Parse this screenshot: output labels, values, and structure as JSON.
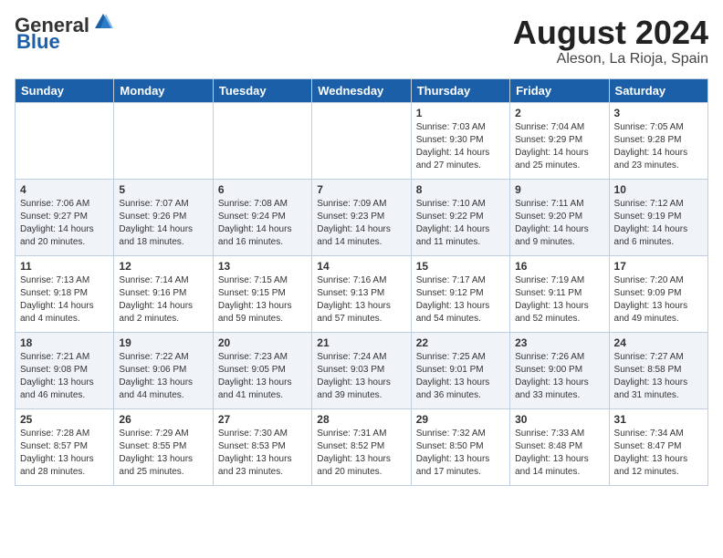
{
  "header": {
    "logo_general": "General",
    "logo_blue": "Blue",
    "month_year": "August 2024",
    "location": "Aleson, La Rioja, Spain"
  },
  "weekdays": [
    "Sunday",
    "Monday",
    "Tuesday",
    "Wednesday",
    "Thursday",
    "Friday",
    "Saturday"
  ],
  "weeks": [
    [
      {
        "day": "",
        "info": ""
      },
      {
        "day": "",
        "info": ""
      },
      {
        "day": "",
        "info": ""
      },
      {
        "day": "",
        "info": ""
      },
      {
        "day": "1",
        "info": "Sunrise: 7:03 AM\nSunset: 9:30 PM\nDaylight: 14 hours\nand 27 minutes."
      },
      {
        "day": "2",
        "info": "Sunrise: 7:04 AM\nSunset: 9:29 PM\nDaylight: 14 hours\nand 25 minutes."
      },
      {
        "day": "3",
        "info": "Sunrise: 7:05 AM\nSunset: 9:28 PM\nDaylight: 14 hours\nand 23 minutes."
      }
    ],
    [
      {
        "day": "4",
        "info": "Sunrise: 7:06 AM\nSunset: 9:27 PM\nDaylight: 14 hours\nand 20 minutes."
      },
      {
        "day": "5",
        "info": "Sunrise: 7:07 AM\nSunset: 9:26 PM\nDaylight: 14 hours\nand 18 minutes."
      },
      {
        "day": "6",
        "info": "Sunrise: 7:08 AM\nSunset: 9:24 PM\nDaylight: 14 hours\nand 16 minutes."
      },
      {
        "day": "7",
        "info": "Sunrise: 7:09 AM\nSunset: 9:23 PM\nDaylight: 14 hours\nand 14 minutes."
      },
      {
        "day": "8",
        "info": "Sunrise: 7:10 AM\nSunset: 9:22 PM\nDaylight: 14 hours\nand 11 minutes."
      },
      {
        "day": "9",
        "info": "Sunrise: 7:11 AM\nSunset: 9:20 PM\nDaylight: 14 hours\nand 9 minutes."
      },
      {
        "day": "10",
        "info": "Sunrise: 7:12 AM\nSunset: 9:19 PM\nDaylight: 14 hours\nand 6 minutes."
      }
    ],
    [
      {
        "day": "11",
        "info": "Sunrise: 7:13 AM\nSunset: 9:18 PM\nDaylight: 14 hours\nand 4 minutes."
      },
      {
        "day": "12",
        "info": "Sunrise: 7:14 AM\nSunset: 9:16 PM\nDaylight: 14 hours\nand 2 minutes."
      },
      {
        "day": "13",
        "info": "Sunrise: 7:15 AM\nSunset: 9:15 PM\nDaylight: 13 hours\nand 59 minutes."
      },
      {
        "day": "14",
        "info": "Sunrise: 7:16 AM\nSunset: 9:13 PM\nDaylight: 13 hours\nand 57 minutes."
      },
      {
        "day": "15",
        "info": "Sunrise: 7:17 AM\nSunset: 9:12 PM\nDaylight: 13 hours\nand 54 minutes."
      },
      {
        "day": "16",
        "info": "Sunrise: 7:19 AM\nSunset: 9:11 PM\nDaylight: 13 hours\nand 52 minutes."
      },
      {
        "day": "17",
        "info": "Sunrise: 7:20 AM\nSunset: 9:09 PM\nDaylight: 13 hours\nand 49 minutes."
      }
    ],
    [
      {
        "day": "18",
        "info": "Sunrise: 7:21 AM\nSunset: 9:08 PM\nDaylight: 13 hours\nand 46 minutes."
      },
      {
        "day": "19",
        "info": "Sunrise: 7:22 AM\nSunset: 9:06 PM\nDaylight: 13 hours\nand 44 minutes."
      },
      {
        "day": "20",
        "info": "Sunrise: 7:23 AM\nSunset: 9:05 PM\nDaylight: 13 hours\nand 41 minutes."
      },
      {
        "day": "21",
        "info": "Sunrise: 7:24 AM\nSunset: 9:03 PM\nDaylight: 13 hours\nand 39 minutes."
      },
      {
        "day": "22",
        "info": "Sunrise: 7:25 AM\nSunset: 9:01 PM\nDaylight: 13 hours\nand 36 minutes."
      },
      {
        "day": "23",
        "info": "Sunrise: 7:26 AM\nSunset: 9:00 PM\nDaylight: 13 hours\nand 33 minutes."
      },
      {
        "day": "24",
        "info": "Sunrise: 7:27 AM\nSunset: 8:58 PM\nDaylight: 13 hours\nand 31 minutes."
      }
    ],
    [
      {
        "day": "25",
        "info": "Sunrise: 7:28 AM\nSunset: 8:57 PM\nDaylight: 13 hours\nand 28 minutes."
      },
      {
        "day": "26",
        "info": "Sunrise: 7:29 AM\nSunset: 8:55 PM\nDaylight: 13 hours\nand 25 minutes."
      },
      {
        "day": "27",
        "info": "Sunrise: 7:30 AM\nSunset: 8:53 PM\nDaylight: 13 hours\nand 23 minutes."
      },
      {
        "day": "28",
        "info": "Sunrise: 7:31 AM\nSunset: 8:52 PM\nDaylight: 13 hours\nand 20 minutes."
      },
      {
        "day": "29",
        "info": "Sunrise: 7:32 AM\nSunset: 8:50 PM\nDaylight: 13 hours\nand 17 minutes."
      },
      {
        "day": "30",
        "info": "Sunrise: 7:33 AM\nSunset: 8:48 PM\nDaylight: 13 hours\nand 14 minutes."
      },
      {
        "day": "31",
        "info": "Sunrise: 7:34 AM\nSunset: 8:47 PM\nDaylight: 13 hours\nand 12 minutes."
      }
    ]
  ]
}
